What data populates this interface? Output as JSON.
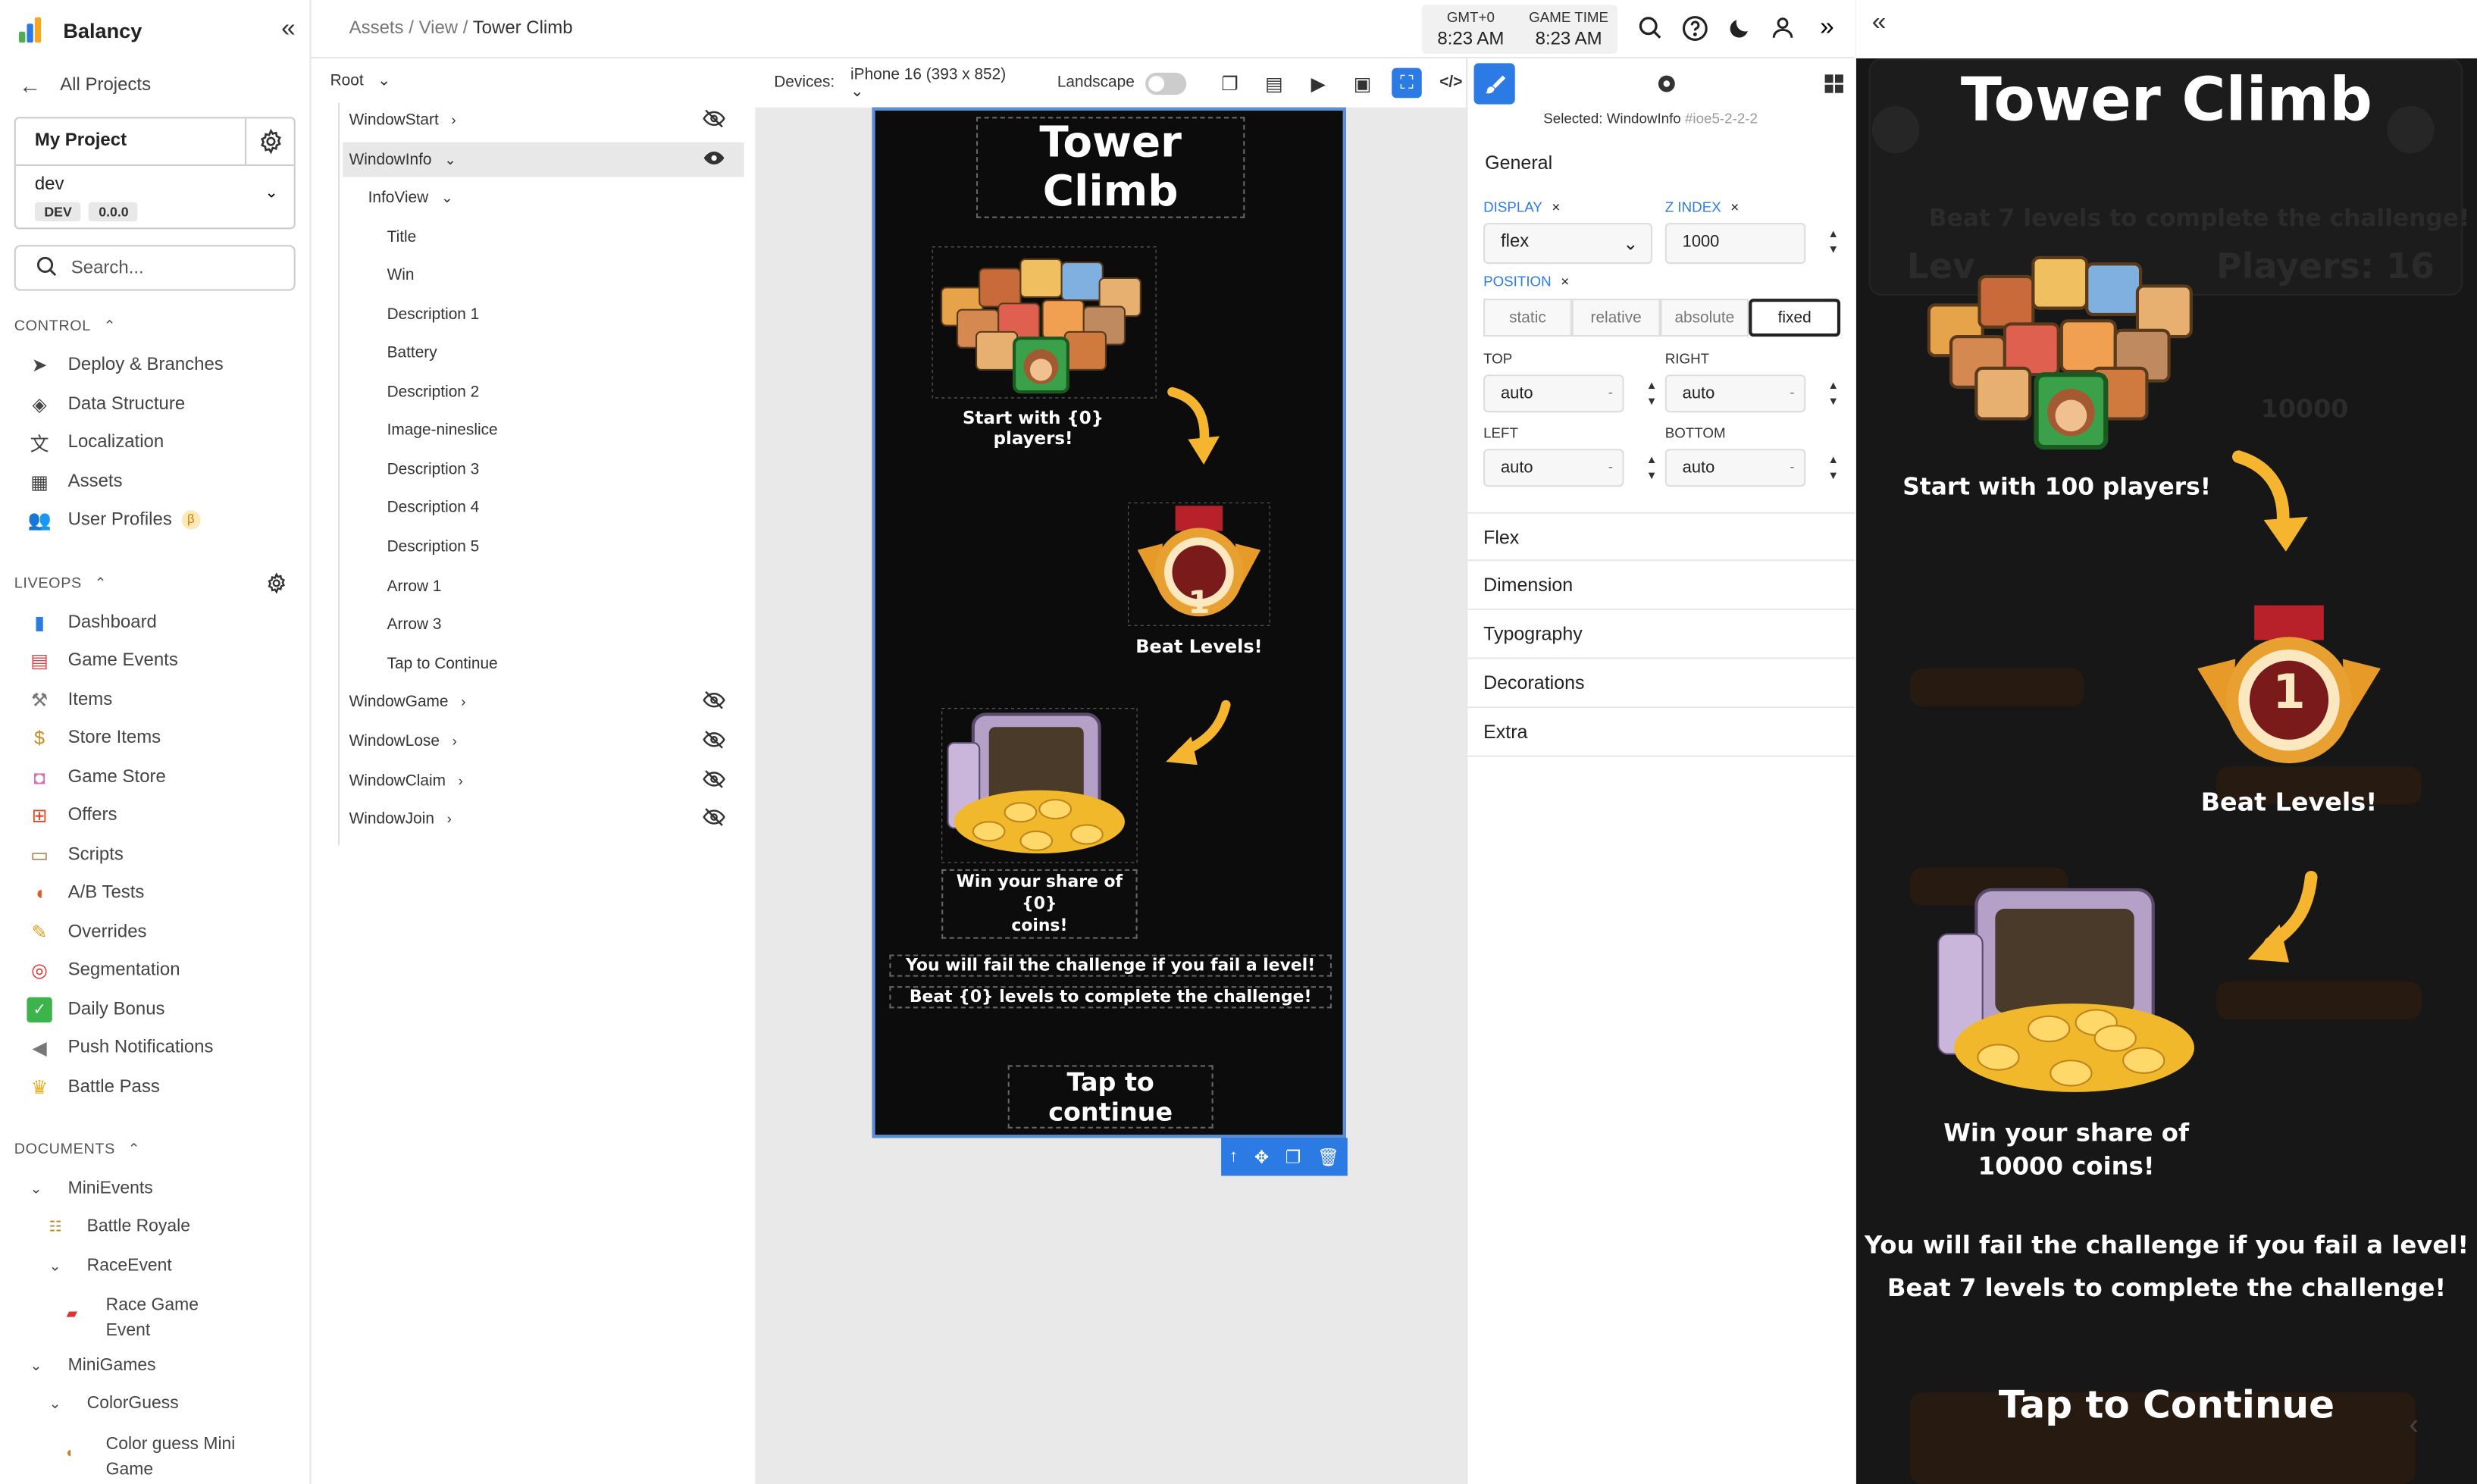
{
  "app": {
    "name": "Balancy"
  },
  "sidebar": {
    "back_label": "All Projects",
    "project_name": "My Project",
    "env_name": "dev",
    "env_badge": "DEV",
    "env_version": "0.0.0",
    "search_placeholder": "Search...",
    "control_label": "CONTROL",
    "control_items": [
      {
        "label": "Deploy & Branches",
        "icon": "paper-plane-icon"
      },
      {
        "label": "Data Structure",
        "icon": "cube-icon"
      },
      {
        "label": "Localization",
        "icon": "translate-icon"
      },
      {
        "label": "Assets",
        "icon": "assets-icon"
      },
      {
        "label": "User Profiles",
        "icon": "users-icon",
        "badge": "β"
      }
    ],
    "liveops_label": "LIVEOPS",
    "liveops_items": [
      {
        "label": "Dashboard",
        "icon": "bar-chart-icon"
      },
      {
        "label": "Game Events",
        "icon": "calendar-icon"
      },
      {
        "label": "Items",
        "icon": "hammer-icon"
      },
      {
        "label": "Store Items",
        "icon": "money-bag-icon"
      },
      {
        "label": "Game Store",
        "icon": "shopping-bag-icon"
      },
      {
        "label": "Offers",
        "icon": "gift-icon"
      },
      {
        "label": "Scripts",
        "icon": "scroll-icon"
      },
      {
        "label": "A/B Tests",
        "icon": "pill-icon"
      },
      {
        "label": "Overrides",
        "icon": "pencil-icon"
      },
      {
        "label": "Segmentation",
        "icon": "target-icon"
      },
      {
        "label": "Daily Bonus",
        "icon": "check-icon"
      },
      {
        "label": "Push Notifications",
        "icon": "megaphone-icon"
      },
      {
        "label": "Battle Pass",
        "icon": "crown-icon"
      }
    ],
    "documents_label": "DOCUMENTS",
    "tree": {
      "mini_events": "MiniEvents",
      "battle_royale": "Battle Royale",
      "race_event": "RaceEvent",
      "race_game_event_1": "Race Game",
      "race_game_event_2": "Event",
      "mini_games": "MiniGames",
      "color_guess": "ColorGuess",
      "color_guess_game_1": "Color guess Mini",
      "color_guess_game_2": "Game"
    }
  },
  "topbar": {
    "crumb_1": "Assets",
    "crumb_2": "View",
    "crumb_3": "Tower Climb",
    "sep": "/",
    "clock_label_1": "GMT+0",
    "clock_value_1": "8:23 AM",
    "clock_label_2": "GAME TIME",
    "clock_value_2": "8:23 AM"
  },
  "hierarchy": {
    "root": "Root",
    "window_start": "WindowStart",
    "window_info": "WindowInfo",
    "info_view": "InfoView",
    "children": [
      "Title",
      "Win",
      "Description 1",
      "Battery",
      "Description 2",
      "Image-nineslice",
      "Description 3",
      "Description 4",
      "Description 5",
      "Arrow 1",
      "Arrow 3",
      "Tap to Continue"
    ],
    "window_game": "WindowGame",
    "window_lose": "WindowLose",
    "window_claim": "WindowClaim",
    "window_join": "WindowJoin"
  },
  "devices": {
    "label": "Devices:",
    "device": "iPhone 16",
    "dims": "(393 x 852)",
    "landscape": "Landscape"
  },
  "phone": {
    "title": "Tower Climb",
    "start": "Start with {0} players!",
    "beat": "Beat Levels!",
    "win_1": "Win your share of {0}",
    "win_2": "coins!",
    "fail": "You will fail the challenge if you fail a level!",
    "beat_n": "Beat {0} levels to complete the challenge!",
    "tap": "Tap to continue",
    "medal": "1"
  },
  "props": {
    "selected_label": "Selected:",
    "selected_name": "WindowInfo",
    "selected_id": "#ioe5-2-2-2",
    "general": "General",
    "display_label": "DISPLAY",
    "display_value": "flex",
    "zindex_label": "Z INDEX",
    "zindex_value": "1000",
    "position_label": "POSITION",
    "position_options": [
      "static",
      "relative",
      "absolute",
      "fixed"
    ],
    "position_selected": "fixed",
    "top_label": "TOP",
    "top_value": "auto",
    "right_label": "RIGHT",
    "right_value": "auto",
    "left_label": "LEFT",
    "left_value": "auto",
    "bottom_label": "BOTTOM",
    "bottom_value": "auto",
    "x_mark": "×",
    "dash": "-",
    "sections": [
      "Flex",
      "Dimension",
      "Typography",
      "Decorations",
      "Extra"
    ]
  },
  "preview": {
    "title": "Tower Climb",
    "start": "Start with 100 players!",
    "beat": "Beat Levels!",
    "win_1": "Win your share of",
    "win_2": "10000 coins!",
    "fail": "You will fail the challenge if you fail a level!",
    "beat_n": "Beat 7 levels to complete the challenge!",
    "tap": "Tap to Continue",
    "medal": "1",
    "ghost_beat": "Beat 7 levels to complete the challenge!",
    "ghost_lev": "Lev",
    "ghost_players": "Players: 16",
    "ghost_coins": "10000"
  },
  "colors": {
    "accent": "#2c7be5",
    "gold": "#f5b52e",
    "medal_red": "#b8202a"
  }
}
